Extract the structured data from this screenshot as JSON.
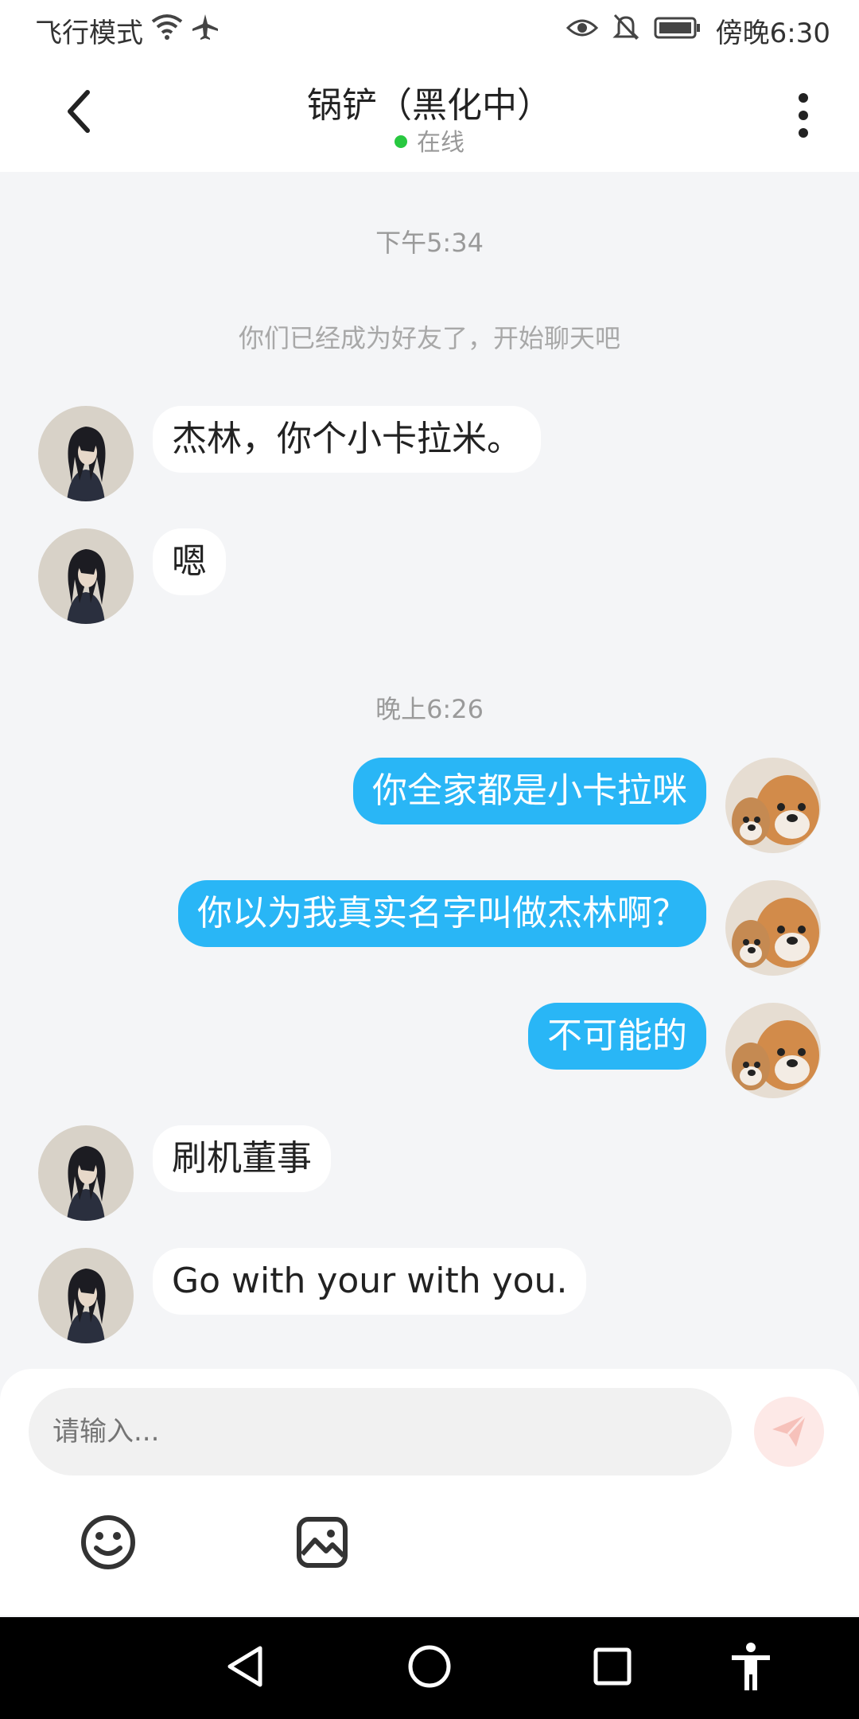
{
  "status_bar": {
    "mode_label": "飞行模式",
    "clock": "傍晚6:30"
  },
  "header": {
    "title": "锅铲（黑化中）",
    "status": "在线"
  },
  "chat": {
    "time1": "下午5:34",
    "system_notice": "你们已经成为好友了，开始聊天吧",
    "time2": "晚上6:26",
    "messages": [
      {
        "side": "left",
        "text": "杰林，你个小卡拉米。"
      },
      {
        "side": "left",
        "text": "嗯"
      },
      {
        "side": "right",
        "text": "你全家都是小卡拉咪"
      },
      {
        "side": "right",
        "text": "你以为我真实名字叫做杰林啊？"
      },
      {
        "side": "right",
        "text": "不可能的"
      },
      {
        "side": "left",
        "text": "刷机董事"
      },
      {
        "side": "left",
        "text": "Go with your with you."
      }
    ]
  },
  "composer": {
    "placeholder": "请输入..."
  },
  "icons": {
    "back": "chevron-left-icon",
    "more": "more-vertical-icon",
    "send": "send-icon",
    "emoji": "emoji-icon",
    "image": "image-icon"
  },
  "colors": {
    "accent": "#29b6f6",
    "online": "#28c840",
    "send_disabled": "#fde9e7"
  }
}
